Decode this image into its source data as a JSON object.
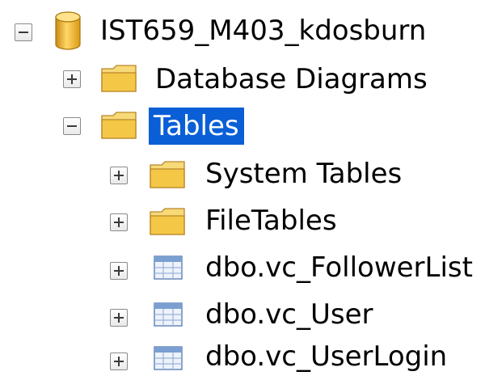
{
  "database": {
    "name": "IST659_M403_kdosburn",
    "expanded": true,
    "icon": "database-cylinder-icon"
  },
  "folders": {
    "database_diagrams": {
      "label": "Database Diagrams",
      "expanded": false,
      "icon": "folder-icon"
    },
    "tables": {
      "label": "Tables",
      "expanded": true,
      "selected": true,
      "icon": "folder-icon"
    }
  },
  "tables_children": {
    "system_tables": {
      "label": "System Tables",
      "expanded": false,
      "icon": "folder-icon"
    },
    "file_tables": {
      "label": "FileTables",
      "expanded": false,
      "icon": "folder-icon"
    },
    "follower_list": {
      "label": "dbo.vc_FollowerList",
      "expanded": false,
      "icon": "table-icon"
    },
    "user": {
      "label": "dbo.vc_User",
      "expanded": false,
      "icon": "table-icon"
    },
    "user_login": {
      "label": "dbo.vc_UserLogin",
      "expanded": false,
      "icon": "table-icon"
    }
  },
  "colors": {
    "selection": "#0a5fd7",
    "folder_body": "#f2c94c",
    "database_body": "#f0b429",
    "table_header": "#7b9fd1"
  }
}
